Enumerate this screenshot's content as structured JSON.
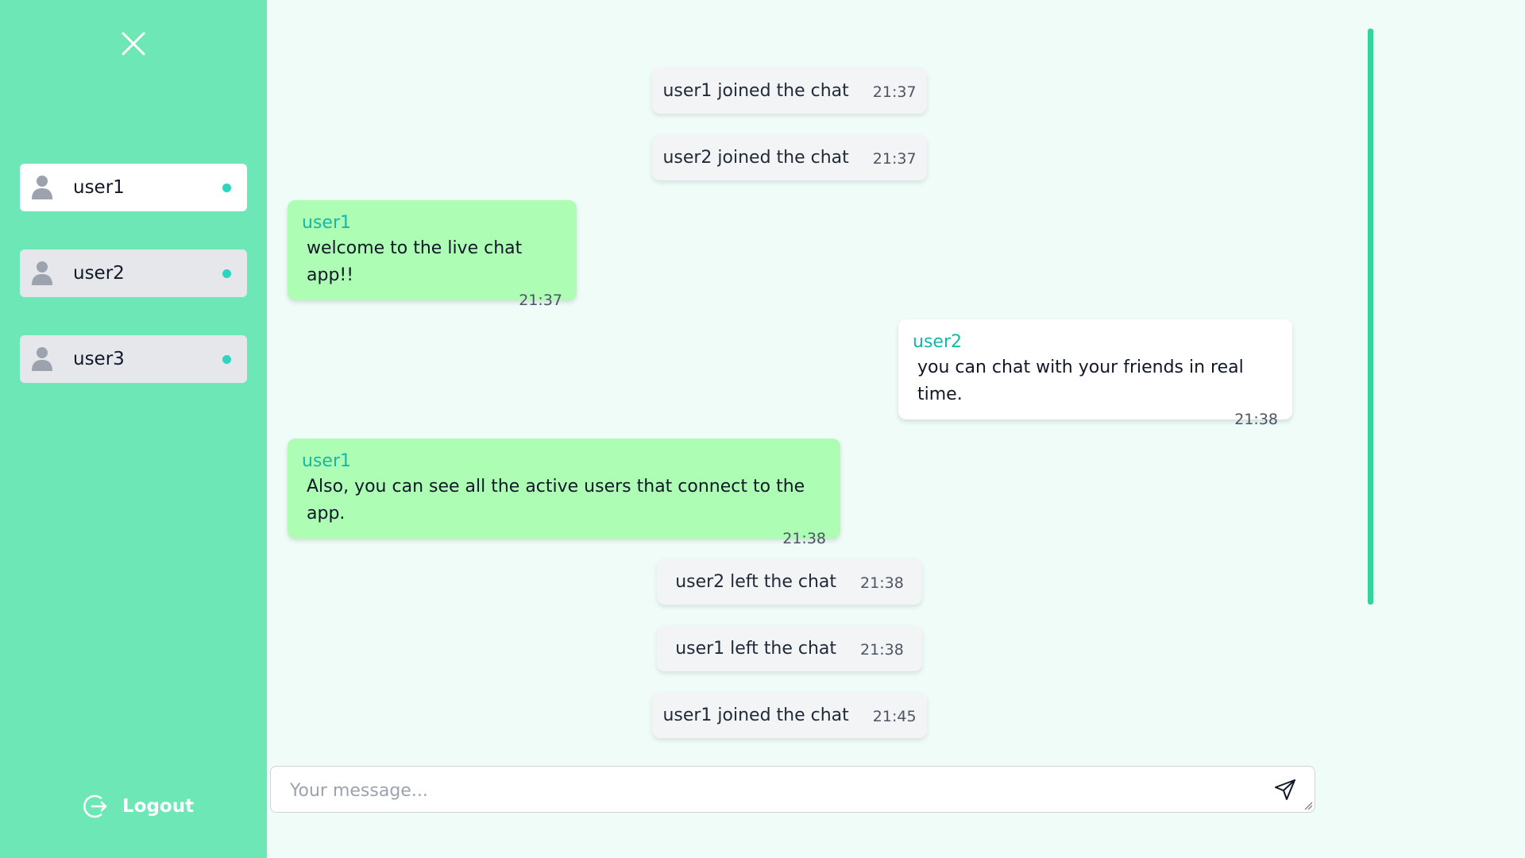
{
  "sidebar": {
    "users": [
      {
        "name": "user1",
        "active": true
      },
      {
        "name": "user2",
        "active": false
      },
      {
        "name": "user3",
        "active": false
      }
    ],
    "logout_label": "Logout"
  },
  "chat": {
    "messages": [
      {
        "kind": "system",
        "text": "user1 joined the chat",
        "time": "21:37"
      },
      {
        "kind": "system",
        "text": "user2 joined the chat",
        "time": "21:37"
      },
      {
        "kind": "mine",
        "author": "user1",
        "text": "welcome to the live chat app!!",
        "time": "21:37"
      },
      {
        "kind": "other",
        "author": "user2",
        "text": "you can chat with your friends in real time.",
        "time": "21:38"
      },
      {
        "kind": "mine",
        "author": "user1",
        "text": "Also, you can see all the active users that connect to the app.",
        "time": "21:38"
      },
      {
        "kind": "system",
        "text": "user2 left the chat",
        "time": "21:38"
      },
      {
        "kind": "system",
        "text": "user1 left the chat",
        "time": "21:38"
      },
      {
        "kind": "system",
        "text": "user1 joined the chat",
        "time": "21:45"
      }
    ],
    "composer": {
      "placeholder": "Your message...",
      "value": ""
    }
  },
  "colors": {
    "sidebar_bg": "#6de7b6",
    "chat_bg": "#effcf8",
    "own_bubble": "#adfdb5",
    "author_name": "#14b8a6",
    "online_dot": "#2dd4bf",
    "scrollbar": "#34d399"
  },
  "icons": {
    "close": "close-icon",
    "user_avatar": "user-icon",
    "online": "online-dot",
    "logout": "logout-icon",
    "send": "send-icon"
  }
}
